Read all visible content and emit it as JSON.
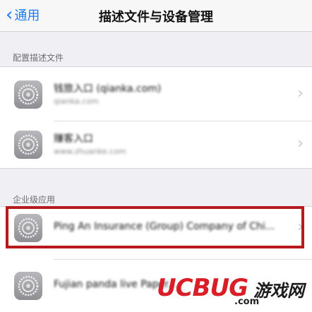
{
  "nav": {
    "back_label": "通用",
    "title": "描述文件与设备管理"
  },
  "sections": {
    "profiles_header": "配置描述文件",
    "enterprise_header": "企业级应用"
  },
  "profiles": [
    {
      "title": "钱旅入口 (qianka.com)",
      "subtitle": "qianka.com"
    },
    {
      "title": "赚客入口",
      "subtitle": "www.zhuanke.com"
    }
  ],
  "enterprise": [
    {
      "title": "Ping An Insurance (Group) Company of Chi..."
    },
    {
      "title": "Fujian panda live Paper..."
    }
  ],
  "watermark": {
    "logo": "UCBUG",
    "cn": "游戏网",
    "domain": ".com"
  }
}
